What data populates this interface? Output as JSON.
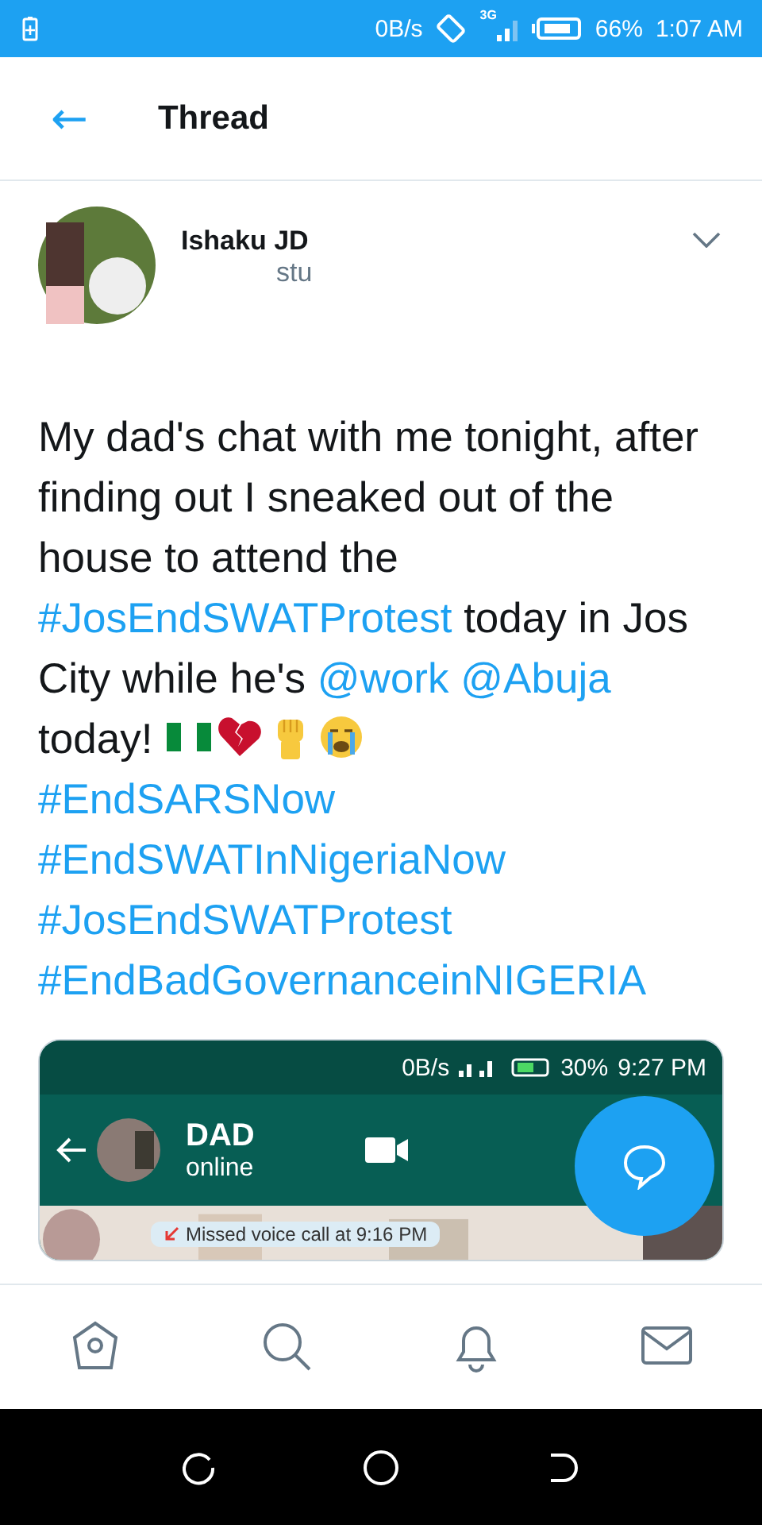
{
  "status_bar": {
    "speed": "0B/s",
    "network": "3G",
    "battery": "66%",
    "time": "1:07 AM"
  },
  "header": {
    "back": "←",
    "title": "Thread"
  },
  "tweet": {
    "author": "Ishaku JD",
    "handle": "stu",
    "text_parts": [
      {
        "kind": "text",
        "text": "My dad's chat with me tonight, after finding out I sneaked out of the house to attend the"
      },
      {
        "kind": "link",
        "text": "#JosEndSWATProtest"
      },
      {
        "kind": "text",
        "text": "today in Jos City while he's"
      },
      {
        "kind": "link",
        "text": "@work"
      },
      {
        "kind": "link",
        "text": "@Abuja"
      },
      {
        "kind": "text",
        "text": "today!"
      },
      {
        "kind": "flag"
      },
      {
        "kind": "heartbreak"
      },
      {
        "kind": "fist"
      },
      {
        "kind": "crying"
      }
    ],
    "hashtag_lines": [
      "#EndSARSNow",
      "#EndSWATInNigeriaNow",
      "#JosEndSWATProtest",
      "#EndBadGovernanceinNIGERIA"
    ],
    "media": {
      "status": {
        "speed": "0B/s",
        "battery": "30%",
        "time": "9:27 PM"
      },
      "contact": "DAD",
      "presence": "online",
      "message": "Missed voice call at 9:16 PM"
    }
  },
  "nav": [
    {
      "selected": false
    },
    {
      "selected": false
    },
    {
      "selected": false
    },
    {
      "selected": false
    }
  ]
}
